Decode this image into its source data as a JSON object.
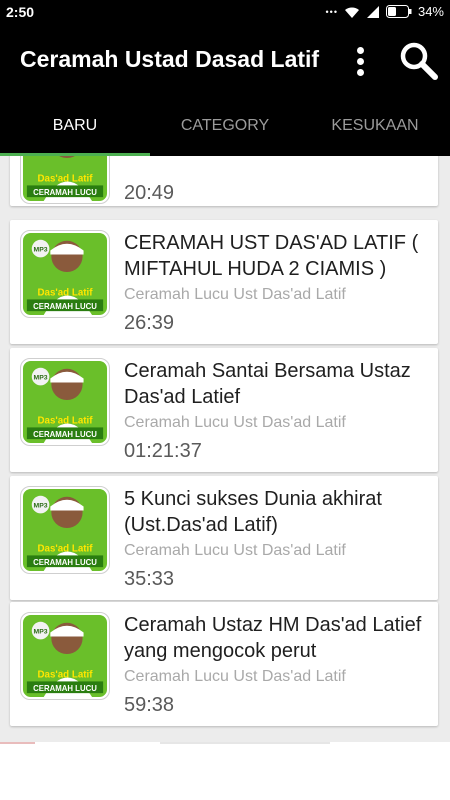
{
  "status": {
    "time": "2:50",
    "battery": "34%"
  },
  "appbar": {
    "title": "Ceramah Ustad Dasad Latif",
    "more_icon": "more-vert-icon",
    "search_icon": "search-icon"
  },
  "tabs": [
    {
      "label": "BARU",
      "active": true
    },
    {
      "label": "CATEGORY",
      "active": false
    },
    {
      "label": "KESUKAAN",
      "active": false
    }
  ],
  "thumbnail": {
    "badge": "MP3",
    "line1": "Das'ad Latif",
    "line2": "CERAMAH LUCU"
  },
  "list": {
    "items": [
      {
        "title": "",
        "subtitle": "",
        "duration": "20:49"
      },
      {
        "title": "CERAMAH UST DAS'AD LATIF ( MIFTAHUL HUDA 2 CIAMIS )",
        "subtitle": "Ceramah Lucu Ust Das'ad Latif",
        "duration": "26:39"
      },
      {
        "title": "Ceramah Santai Bersama Ustaz Das'ad Latief",
        "subtitle": "Ceramah Lucu Ust Das'ad Latif",
        "duration": "01:21:37"
      },
      {
        "title": "5 Kunci sukses Dunia akhirat (Ust.Das'ad Latif)",
        "subtitle": "Ceramah Lucu Ust Das'ad Latif",
        "duration": "35:33"
      },
      {
        "title": "Ceramah Ustaz HM Das'ad Latief yang mengocok perut",
        "subtitle": "Ceramah Lucu Ust Das'ad Latif",
        "duration": "59:38"
      }
    ]
  },
  "colors": {
    "accent": "#4caf50",
    "bar": "#000000",
    "list_bg": "#ececec",
    "thumb_green": "#6abf2a"
  }
}
